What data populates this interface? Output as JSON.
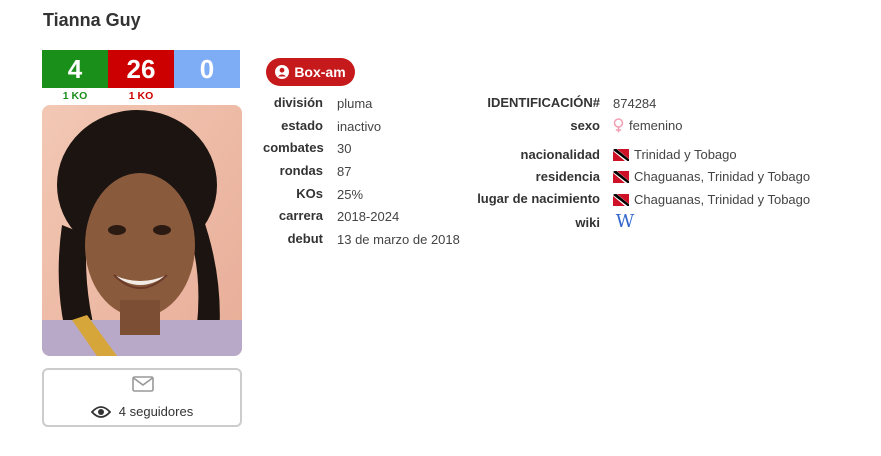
{
  "boxer": {
    "name": "Tianna Guy"
  },
  "record": {
    "wins": "4",
    "losses": "26",
    "draws": "0",
    "wins_ko": "1 KO",
    "losses_ko": "1 KO"
  },
  "colors": {
    "win": "#1a8f1a",
    "loss": "#cc0000",
    "draw": "#7fadf5",
    "accent": "#c6191b"
  },
  "followers": {
    "text": "4 seguidores"
  },
  "boxam": {
    "label": "Box-am"
  },
  "details_left": [
    {
      "label": "división",
      "value": "pluma"
    },
    {
      "label": "estado",
      "value": "inactivo"
    },
    {
      "label": "combates",
      "value": "30"
    },
    {
      "label": "rondas",
      "value": "87"
    },
    {
      "label": "KOs",
      "value": "25%"
    },
    {
      "label": "carrera",
      "value": "2018-2024"
    },
    {
      "label": "debut",
      "value": "13 de marzo de 2018"
    }
  ],
  "details_right": [
    {
      "label": "IDENTIFICACIÓN#",
      "value": "874284"
    },
    {
      "label": "sexo",
      "value": "femenino",
      "icon": "female-icon"
    },
    {
      "label": "nacionalidad",
      "value": "Trinidad y Tobago",
      "icon": "trinidad-flag-icon"
    },
    {
      "label": "residencia",
      "value": "Chaguanas, Trinidad y Tobago",
      "icon": "trinidad-flag-icon"
    },
    {
      "label": "lugar de nacimiento",
      "value": "Chaguanas, Trinidad y Tobago",
      "icon": "trinidad-flag-icon"
    },
    {
      "label": "wiki",
      "value": "",
      "icon": "wikipedia-icon"
    }
  ]
}
